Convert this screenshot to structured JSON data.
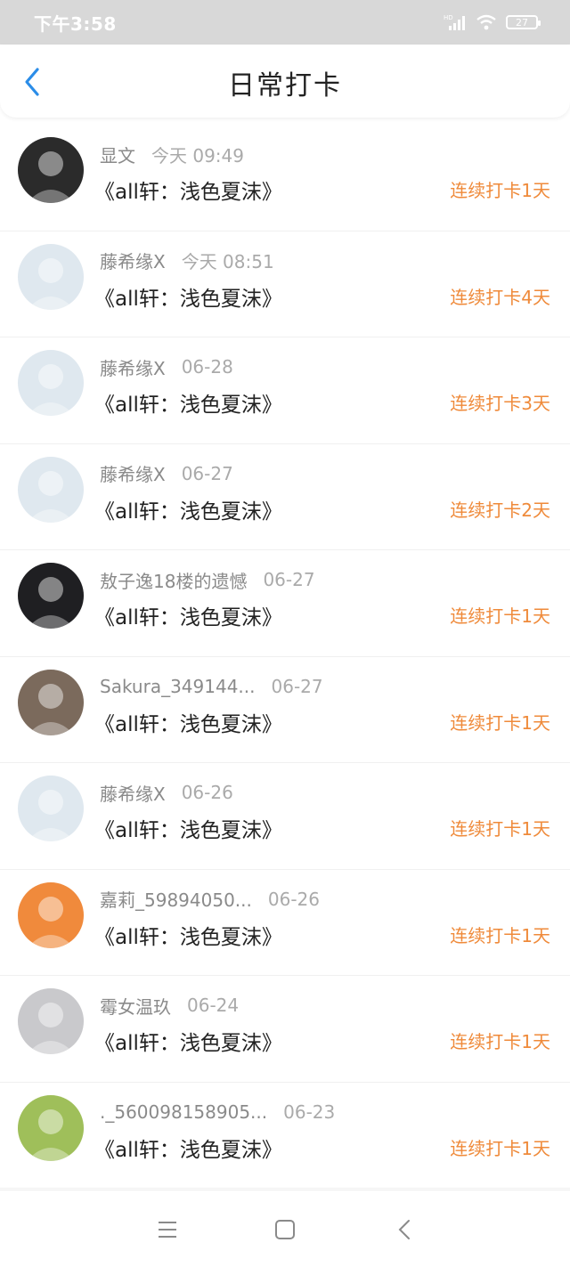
{
  "status_bar": {
    "time": "下午3:58",
    "battery": "27"
  },
  "header": {
    "title": "日常打卡"
  },
  "entries": [
    {
      "name": "显文",
      "time": "今天 09:49",
      "book": "《all轩：浅色夏沫》",
      "streak": "连续打卡1天",
      "avatar_color": "#2b2b2b"
    },
    {
      "name": "藤希缘X",
      "time": "今天 08:51",
      "book": "《all轩：浅色夏沫》",
      "streak": "连续打卡4天",
      "avatar_color": "#dfe8ef"
    },
    {
      "name": "藤希缘X",
      "time": "06-28",
      "book": "《all轩：浅色夏沫》",
      "streak": "连续打卡3天",
      "avatar_color": "#dfe8ef"
    },
    {
      "name": "藤希缘X",
      "time": "06-27",
      "book": "《all轩：浅色夏沫》",
      "streak": "连续打卡2天",
      "avatar_color": "#dfe8ef"
    },
    {
      "name": "敖子逸18楼的遗憾",
      "time": "06-27",
      "book": "《all轩：浅色夏沫》",
      "streak": "连续打卡1天",
      "avatar_color": "#1f1f22"
    },
    {
      "name": "Sakura_349144...",
      "time": "06-27",
      "book": "《all轩：浅色夏沫》",
      "streak": "连续打卡1天",
      "avatar_color": "#7b6a5c"
    },
    {
      "name": "藤希缘X",
      "time": "06-26",
      "book": "《all轩：浅色夏沫》",
      "streak": "连续打卡1天",
      "avatar_color": "#dfe8ef"
    },
    {
      "name": "嘉莉_59894050...",
      "time": "06-26",
      "book": "《all轩：浅色夏沫》",
      "streak": "连续打卡1天",
      "avatar_color": "#f08a3c"
    },
    {
      "name": "霉女温玖",
      "time": "06-24",
      "book": "《all轩：浅色夏沫》",
      "streak": "连续打卡1天",
      "avatar_color": "#c9c9cc"
    },
    {
      "name": "._560098158905...",
      "time": "06-23",
      "book": "《all轩：浅色夏沫》",
      "streak": "连续打卡1天",
      "avatar_color": "#9fbf5a"
    }
  ],
  "colors": {
    "accent": "#ef8a3a",
    "back": "#2b8de8"
  },
  "icons": {
    "back": "chevron-left-icon",
    "menu": "menu-icon",
    "home": "home-square-icon",
    "nav_back": "back-arrow-icon"
  }
}
